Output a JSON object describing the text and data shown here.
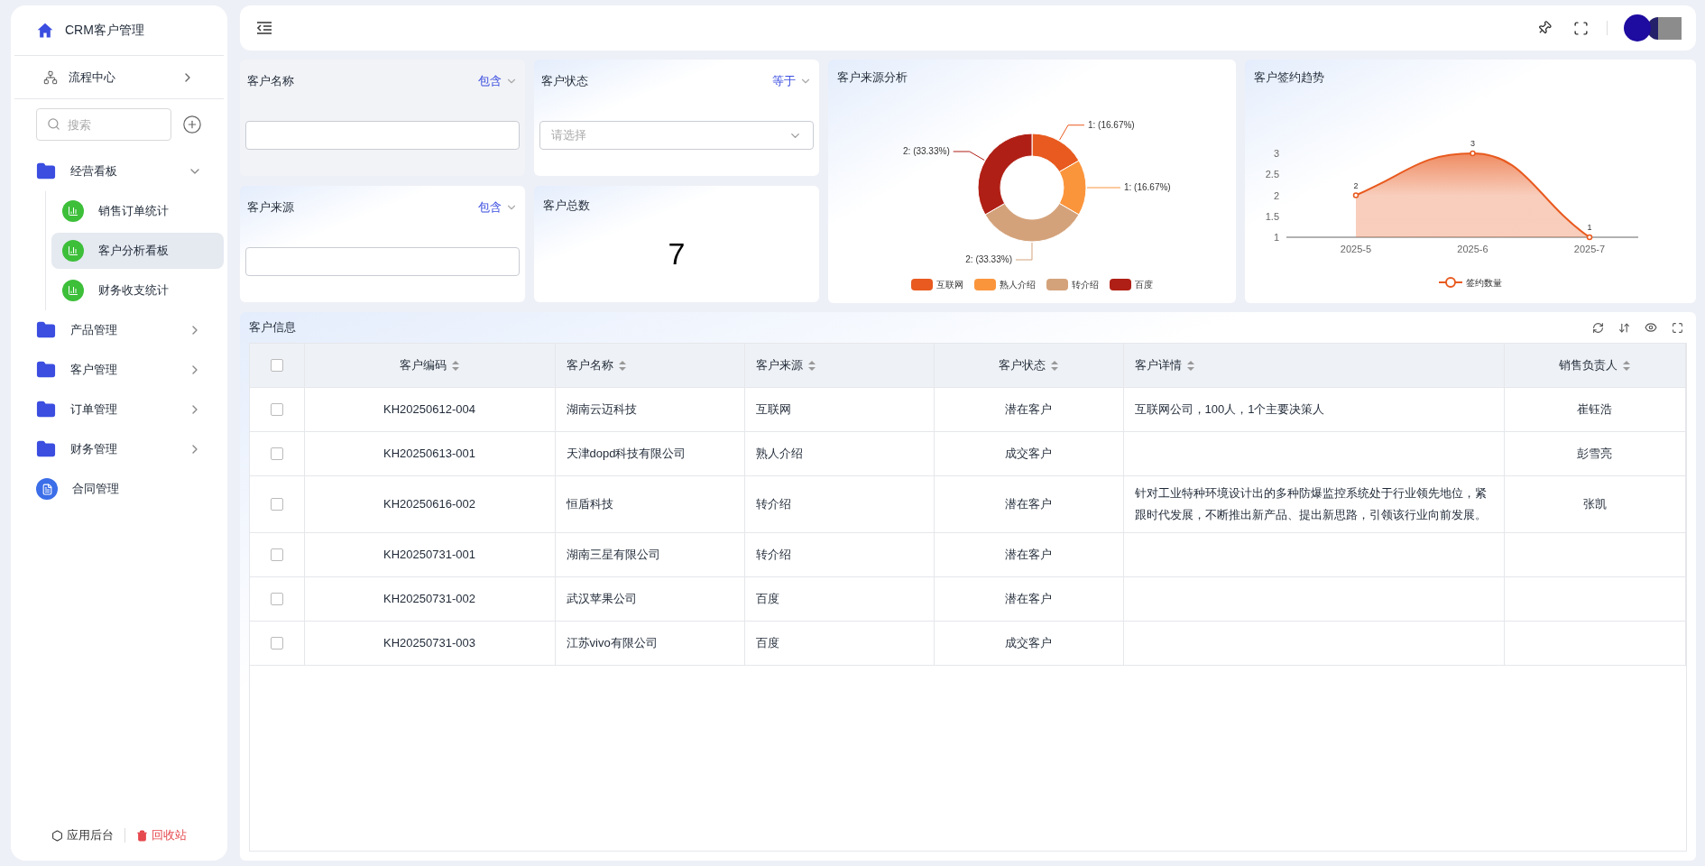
{
  "sidebar": {
    "title": "CRM客户管理",
    "flow_item": "流程中心",
    "search": {
      "placeholder": "搜索"
    },
    "tree": [
      {
        "label": "经营看板",
        "kind": "folder",
        "expanded": true,
        "children": [
          {
            "label": "销售订单统计",
            "kind": "dashboard",
            "selected": false
          },
          {
            "label": "客户分析看板",
            "kind": "dashboard",
            "selected": true
          },
          {
            "label": "财务收支统计",
            "kind": "dashboard",
            "selected": false
          }
        ]
      },
      {
        "label": "产品管理",
        "kind": "folder",
        "expanded": false
      },
      {
        "label": "客户管理",
        "kind": "folder",
        "expanded": false
      },
      {
        "label": "订单管理",
        "kind": "folder",
        "expanded": false
      },
      {
        "label": "财务管理",
        "kind": "folder",
        "expanded": false
      },
      {
        "label": "合同管理",
        "kind": "doc"
      }
    ],
    "footer": {
      "settings": "应用后台",
      "recycle": "回收站"
    }
  },
  "filters": [
    {
      "label": "客户名称",
      "operator": "包含",
      "kind": "text",
      "highlighted": true
    },
    {
      "label": "客户状态",
      "operator": "等于",
      "kind": "select",
      "placeholder": "请选择",
      "highlighted": false
    },
    {
      "label": "客户来源",
      "operator": "包含",
      "kind": "text",
      "highlighted": false
    }
  ],
  "stat": {
    "label": "客户总数",
    "value": "7"
  },
  "source_chart": {
    "title": "客户来源分析",
    "chart_data": {
      "type": "donut",
      "categories": [
        "互联网",
        "熟人介绍",
        "转介绍",
        "百度"
      ],
      "values": [
        16.67,
        16.67,
        33.33,
        33.33
      ],
      "colors": [
        "#e85a1f",
        "#fb953c",
        "#d4a27a",
        "#b01f15"
      ],
      "legend": "bottom",
      "value_labels": [
        "1: (16.67%)",
        "1: (16.67%)",
        "2: (33.33%)",
        "2: (33.33%)"
      ]
    }
  },
  "trend_chart": {
    "title": "客户签约趋势",
    "chart_data": {
      "type": "area",
      "categories": [
        "2025-5",
        "2025-6",
        "2025-7"
      ],
      "series": [
        {
          "name": "签约数量",
          "color": "#e85a1f",
          "values": [
            2,
            3,
            1
          ]
        }
      ],
      "ylim": [
        1,
        3
      ],
      "yticks": [
        1,
        1.5,
        2,
        2.5,
        3
      ],
      "data_labels": true
    }
  },
  "table": {
    "title": "客户信息",
    "select_all_checked": false,
    "columns": [
      {
        "label": "客户编码"
      },
      {
        "label": "客户名称"
      },
      {
        "label": "客户来源"
      },
      {
        "label": "客户状态"
      },
      {
        "label": "客户详情"
      },
      {
        "label": "销售负责人"
      }
    ],
    "rows": [
      {
        "checked": false,
        "cells": [
          "KH20250612-004",
          "湖南云迈科技",
          "互联网",
          "潜在客户",
          "互联网公司，100人，1个主要决策人",
          "崔钰浩"
        ]
      },
      {
        "checked": false,
        "cells": [
          "KH20250613-001",
          "天津dopd科技有限公司",
          "熟人介绍",
          "成交客户",
          "",
          "彭雪亮"
        ]
      },
      {
        "checked": false,
        "cells": [
          "KH20250616-002",
          "恒盾科技",
          "转介绍",
          "潜在客户",
          "针对工业特种环境设计出的多种防爆监控系统处于行业领先地位，紧跟时代发展，不断推出新产品、提出新思路，引领该行业向前发展。",
          "张凯"
        ]
      },
      {
        "checked": false,
        "cells": [
          "KH20250731-001",
          "湖南三星有限公司",
          "转介绍",
          "潜在客户",
          "",
          ""
        ]
      },
      {
        "checked": false,
        "cells": [
          "KH20250731-002",
          "武汉苹果公司",
          "百度",
          "潜在客户",
          "",
          ""
        ]
      },
      {
        "checked": false,
        "cells": [
          "KH20250731-003",
          "江苏vivo有限公司",
          "百度",
          "成交客户",
          "",
          ""
        ]
      }
    ]
  }
}
